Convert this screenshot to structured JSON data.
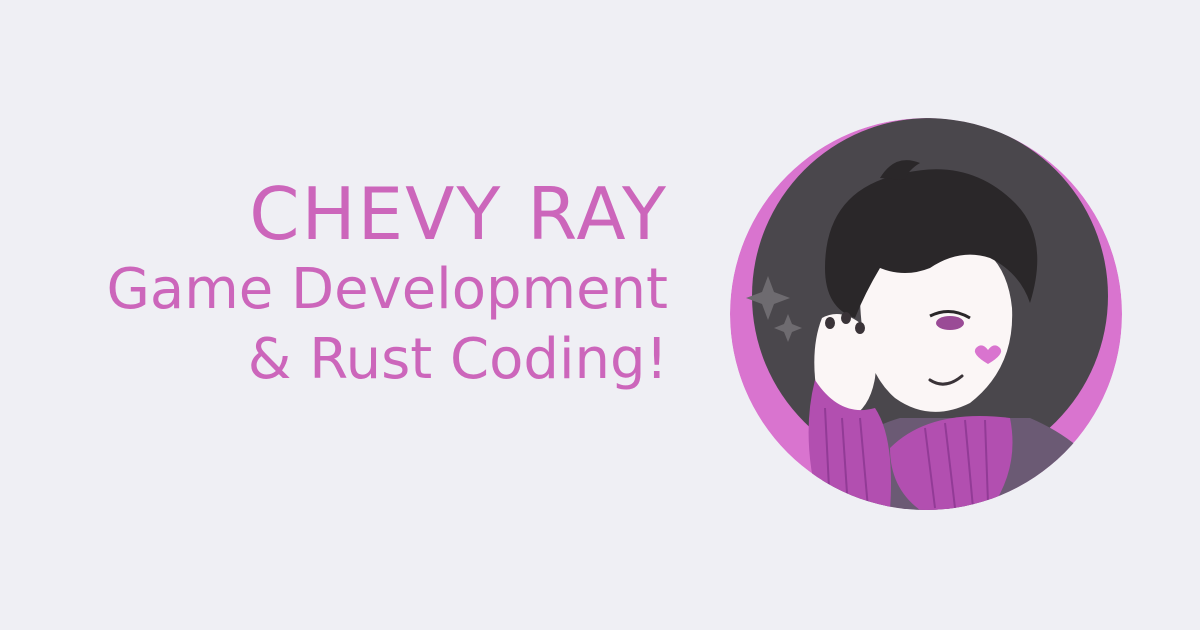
{
  "banner": {
    "title": "CHEVY RAY",
    "subtitle_line1": "Game Development",
    "subtitle_line2": "& Rust Coding!"
  },
  "colors": {
    "background": "#efeff4",
    "accent": "#cc66bb",
    "avatar_dark": "#4a474c",
    "avatar_pink": "#d974cf",
    "avatar_sweater": "#b24fb0"
  },
  "avatar": {
    "icon": "avatar-portrait-illustration"
  }
}
